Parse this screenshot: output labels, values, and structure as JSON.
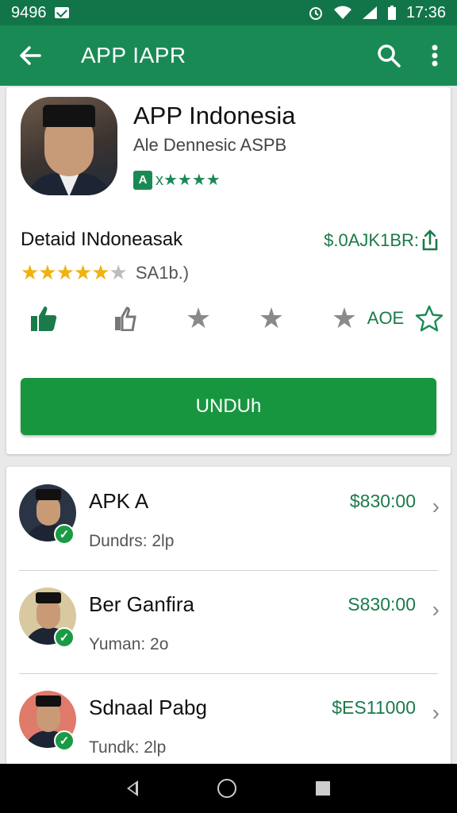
{
  "status_bar": {
    "left_text": "9496",
    "time": "17:36"
  },
  "app_bar": {
    "title": "APP IAPR"
  },
  "app_info": {
    "name": "APP Indonesia",
    "subtitle": "Ale Dennesic ASPB",
    "badge_letter": "A",
    "badge_text": "x★★★★"
  },
  "details": {
    "label": "Detaid INdoneasak",
    "price": "$.0AJK1BR:",
    "rating_value": 5,
    "rating_max": 6,
    "rating_count": "SA1b.)"
  },
  "actions": {
    "tag_label": "AOE"
  },
  "download_button": {
    "label": "UNDUh"
  },
  "list": [
    {
      "title": "APK A",
      "subtitle": "Dundrs: 2lp",
      "price": "$830:00"
    },
    {
      "title": "Ber Ganfira",
      "subtitle": "Yuman: 2o",
      "price": "S830:00"
    },
    {
      "title": "Sdnaal Pabg",
      "subtitle": "Tundk: 2lp",
      "price": "$ES11000"
    }
  ],
  "colors": {
    "primary": "#1a8a55",
    "status_bar": "#12754a",
    "button": "#17963f",
    "star": "#f0b20f"
  },
  "icons": {
    "back": "arrow-left-icon",
    "search": "search-icon",
    "more": "more-vert-icon",
    "share": "share-icon",
    "thumbs_up": "thumbs-up-icon",
    "thumbs_down": "thumbs-down-icon",
    "star": "star-icon",
    "check": "check-icon",
    "chevron": "chevron-right-icon"
  }
}
